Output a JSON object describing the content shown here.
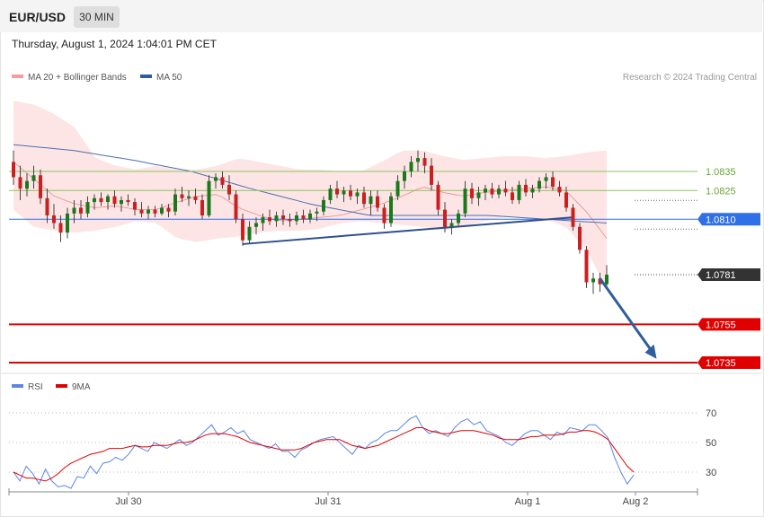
{
  "header": {
    "symbol": "EUR/USD",
    "timeframe": "30 MIN"
  },
  "datetime": "Thursday, August 1, 2024 1:04:01 PM CET",
  "credit": "Research © 2024 Trading Central",
  "colors": {
    "bollinger": "#f99b9b",
    "ma50": "#2f5d9e",
    "rsi": "#5b86e5",
    "ma9": "#e00000",
    "support": "#e00000",
    "pivot": "#2f6fe8",
    "resistance": "#8fc25e",
    "current": "#333333"
  },
  "price_legend": [
    {
      "label": "MA 20 + Bollinger Bands",
      "color": "#f99b9b"
    },
    {
      "label": "MA 50",
      "color": "#2f5d9e"
    }
  ],
  "rsi_legend": [
    {
      "label": "RSI",
      "color": "#5b86e5"
    },
    {
      "label": "9MA",
      "color": "#e00000"
    }
  ],
  "chart_data": [
    {
      "type": "candlestick",
      "x_ticks": [
        "Jul 30",
        "Jul 31",
        "Aug 1",
        "Aug 2"
      ],
      "ylim": [
        1.0728,
        1.0885
      ],
      "levels": [
        {
          "value": 1.0835,
          "label": "1.0835",
          "kind": "resistance",
          "color": "#8fc25e"
        },
        {
          "value": 1.0825,
          "label": "1.0825",
          "kind": "resistance",
          "color": "#8fc25e"
        },
        {
          "value": 1.081,
          "label": "1.0810",
          "kind": "pivot",
          "color": "#2f6fe8"
        },
        {
          "value": 1.0781,
          "label": "1.0781",
          "kind": "current",
          "color": "#333333"
        },
        {
          "value": 1.0755,
          "label": "1.0755",
          "kind": "support",
          "color": "#e00000"
        },
        {
          "value": 1.0735,
          "label": "1.0735",
          "kind": "support",
          "color": "#e00000"
        }
      ],
      "trendline": {
        "from": {
          "bar": 34,
          "price": 1.0797
        },
        "to": {
          "bar": 83,
          "price": 1.0811
        }
      },
      "forecast_arrow": {
        "from": {
          "bar": 87,
          "price": 1.0779
        },
        "to": {
          "bar": 95,
          "price": 1.0737
        }
      },
      "ohlc": [
        [
          1.084,
          1.0846,
          1.0828,
          1.0832
        ],
        [
          1.0832,
          1.0838,
          1.082,
          1.0826
        ],
        [
          1.0826,
          1.0834,
          1.0822,
          1.083
        ],
        [
          1.083,
          1.0838,
          1.0826,
          1.0833
        ],
        [
          1.0833,
          1.0836,
          1.0818,
          1.0821
        ],
        [
          1.0821,
          1.0826,
          1.0808,
          1.0812
        ],
        [
          1.0812,
          1.0818,
          1.0805,
          1.0808
        ],
        [
          1.0808,
          1.0812,
          1.0798,
          1.0803
        ],
        [
          1.0803,
          1.0816,
          1.08,
          1.0813
        ],
        [
          1.0813,
          1.082,
          1.0808,
          1.0816
        ],
        [
          1.0816,
          1.082,
          1.081,
          1.0813
        ],
        [
          1.0813,
          1.0822,
          1.0811,
          1.0819
        ],
        [
          1.0819,
          1.0823,
          1.0815,
          1.0821
        ],
        [
          1.0821,
          1.0824,
          1.0817,
          1.0819
        ],
        [
          1.0819,
          1.0823,
          1.0815,
          1.0822
        ],
        [
          1.0822,
          1.0825,
          1.0816,
          1.0818
        ],
        [
          1.0818,
          1.0822,
          1.0814,
          1.082
        ],
        [
          1.082,
          1.0823,
          1.0817,
          1.0819
        ],
        [
          1.0819,
          1.0821,
          1.0812,
          1.0815
        ],
        [
          1.0815,
          1.0819,
          1.0811,
          1.0813
        ],
        [
          1.0813,
          1.0817,
          1.081,
          1.0815
        ],
        [
          1.0815,
          1.0817,
          1.0811,
          1.0813
        ],
        [
          1.0813,
          1.0818,
          1.0812,
          1.0816
        ],
        [
          1.0816,
          1.0818,
          1.0811,
          1.0814
        ],
        [
          1.0814,
          1.0826,
          1.0812,
          1.0823
        ],
        [
          1.0823,
          1.0827,
          1.0819,
          1.0821
        ],
        [
          1.0821,
          1.0825,
          1.0817,
          1.0822
        ],
        [
          1.0822,
          1.0826,
          1.0818,
          1.082
        ],
        [
          1.082,
          1.0823,
          1.081,
          1.0812
        ],
        [
          1.0812,
          1.0833,
          1.0811,
          1.083
        ],
        [
          1.083,
          1.0834,
          1.0826,
          1.0832
        ],
        [
          1.0832,
          1.0835,
          1.0826,
          1.0828
        ],
        [
          1.0828,
          1.0833,
          1.082,
          1.0823
        ],
        [
          1.0823,
          1.0825,
          1.0808,
          1.081
        ],
        [
          1.081,
          1.0813,
          1.0796,
          1.0799
        ],
        [
          1.0799,
          1.0809,
          1.0797,
          1.0806
        ],
        [
          1.0806,
          1.0811,
          1.0802,
          1.0808
        ],
        [
          1.0808,
          1.0813,
          1.0804,
          1.0811
        ],
        [
          1.0811,
          1.0815,
          1.0807,
          1.0809
        ],
        [
          1.0809,
          1.0814,
          1.0806,
          1.0812
        ],
        [
          1.0812,
          1.0815,
          1.0807,
          1.081
        ],
        [
          1.081,
          1.0813,
          1.0806,
          1.0809
        ],
        [
          1.0809,
          1.0814,
          1.0807,
          1.0812
        ],
        [
          1.0812,
          1.0815,
          1.0808,
          1.081
        ],
        [
          1.081,
          1.0815,
          1.0808,
          1.0813
        ],
        [
          1.0813,
          1.0816,
          1.0809,
          1.0814
        ],
        [
          1.0814,
          1.0822,
          1.0812,
          1.082
        ],
        [
          1.082,
          1.0828,
          1.0818,
          1.0826
        ],
        [
          1.0826,
          1.083,
          1.0821,
          1.0823
        ],
        [
          1.0823,
          1.0827,
          1.0819,
          1.0825
        ],
        [
          1.0825,
          1.0828,
          1.082,
          1.0822
        ],
        [
          1.0822,
          1.0826,
          1.0818,
          1.0824
        ],
        [
          1.0824,
          1.0827,
          1.0816,
          1.0818
        ],
        [
          1.0818,
          1.0825,
          1.0812,
          1.0822
        ],
        [
          1.0822,
          1.0825,
          1.0814,
          1.0816
        ],
        [
          1.0816,
          1.0818,
          1.0805,
          1.0808
        ],
        [
          1.0808,
          1.0824,
          1.0806,
          1.0822
        ],
        [
          1.0822,
          1.0833,
          1.082,
          1.083
        ],
        [
          1.083,
          1.0838,
          1.0826,
          1.0835
        ],
        [
          1.0835,
          1.0843,
          1.0832,
          1.084
        ],
        [
          1.084,
          1.0846,
          1.0835,
          1.0842
        ],
        [
          1.0842,
          1.0845,
          1.0834,
          1.0838
        ],
        [
          1.0838,
          1.0842,
          1.0825,
          1.0828
        ],
        [
          1.0828,
          1.083,
          1.0812,
          1.0815
        ],
        [
          1.0815,
          1.0819,
          1.0803,
          1.0806
        ],
        [
          1.0806,
          1.081,
          1.0802,
          1.0808
        ],
        [
          1.0808,
          1.0815,
          1.0806,
          1.0813
        ],
        [
          1.0813,
          1.083,
          1.0811,
          1.0826
        ],
        [
          1.0826,
          1.0829,
          1.0818,
          1.0821
        ],
        [
          1.0821,
          1.0827,
          1.0817,
          1.0824
        ],
        [
          1.0824,
          1.0828,
          1.082,
          1.0826
        ],
        [
          1.0826,
          1.0829,
          1.0821,
          1.0823
        ],
        [
          1.0823,
          1.0828,
          1.0821,
          1.0826
        ],
        [
          1.0826,
          1.083,
          1.0822,
          1.0824
        ],
        [
          1.0824,
          1.0827,
          1.0818,
          1.082
        ],
        [
          1.082,
          1.083,
          1.0818,
          1.0828
        ],
        [
          1.0828,
          1.0831,
          1.0822,
          1.0824
        ],
        [
          1.0824,
          1.0828,
          1.0821,
          1.0826
        ],
        [
          1.0826,
          1.0832,
          1.0824,
          1.083
        ],
        [
          1.083,
          1.0834,
          1.0826,
          1.0832
        ],
        [
          1.0832,
          1.0835,
          1.0825,
          1.0827
        ],
        [
          1.0827,
          1.083,
          1.0822,
          1.0824
        ],
        [
          1.0824,
          1.0827,
          1.0814,
          1.0816
        ],
        [
          1.0816,
          1.0818,
          1.0804,
          1.0806
        ],
        [
          1.0806,
          1.0808,
          1.0792,
          1.0794
        ],
        [
          1.0794,
          1.0796,
          1.0774,
          1.0777
        ],
        [
          1.0777,
          1.0782,
          1.0771,
          1.0779
        ],
        [
          1.0779,
          1.0782,
          1.0772,
          1.0776
        ],
        [
          1.0776,
          1.0786,
          1.0774,
          1.0781
        ]
      ],
      "ma50": [
        1.0849,
        1.0846,
        1.0841,
        1.0835,
        1.0826,
        1.0818,
        1.0812,
        1.0812,
        1.0812,
        1.081,
        1.0808
      ],
      "ma20": [
        1.084,
        1.0831,
        1.0822,
        1.0818,
        1.0816,
        1.0817,
        1.0815,
        1.0815,
        1.0819,
        1.0822,
        1.0823,
        1.0816,
        1.0812,
        1.0809,
        1.081,
        1.0811,
        1.0812,
        1.0815,
        1.0818,
        1.0822,
        1.0827,
        1.0824,
        1.0822,
        1.0824,
        1.0825,
        1.0826,
        1.0827,
        1.0825,
        1.0814,
        1.08
      ],
      "bb_upper": [
        1.0872,
        1.087,
        1.0865,
        1.0858,
        1.0842,
        1.0838,
        1.0836,
        1.0838,
        1.0836,
        1.0836,
        1.0838,
        1.0842,
        1.084,
        1.0838,
        1.0836,
        1.0836,
        1.0835,
        1.0835,
        1.084,
        1.0846,
        1.0846,
        1.0843,
        1.0841,
        1.0842,
        1.0843,
        1.0843,
        1.0842,
        1.0843,
        1.0845,
        1.0846
      ],
      "bb_lower": [
        1.0815,
        1.0806,
        1.0804,
        1.0803,
        1.0804,
        1.0806,
        1.0809,
        1.0808,
        1.08,
        1.0798,
        1.08,
        1.0801,
        1.0803,
        1.0804,
        1.0804,
        1.0805,
        1.0808,
        1.0809,
        1.0808,
        1.0807,
        1.0806,
        1.0804,
        1.0806,
        1.0809,
        1.0811,
        1.0811,
        1.081,
        1.0806,
        1.0794,
        1.0774
      ]
    },
    {
      "type": "line",
      "name": "RSI",
      "ylim": [
        20,
        80
      ],
      "y_ticks": [
        "70",
        "50",
        "30"
      ],
      "y_tick_values": [
        70,
        50,
        30
      ],
      "rsi": [
        30,
        24,
        34,
        29,
        22,
        32,
        24,
        20,
        21,
        19,
        27,
        26,
        34,
        29,
        36,
        37,
        40,
        38,
        42,
        48,
        46,
        44,
        50,
        48,
        46,
        49,
        52,
        48,
        50,
        54,
        58,
        62,
        55,
        57,
        60,
        56,
        58,
        52,
        50,
        48,
        46,
        49,
        44,
        44,
        40,
        45,
        47,
        50,
        52,
        53,
        54,
        50,
        46,
        42,
        48,
        46,
        50,
        52,
        56,
        58,
        58,
        62,
        66,
        68,
        60,
        56,
        58,
        56,
        54,
        60,
        64,
        66,
        62,
        64,
        58,
        56,
        54,
        50,
        48,
        52,
        56,
        58,
        58,
        55,
        52,
        57,
        55,
        60,
        59,
        58,
        62,
        62,
        58,
        53,
        40,
        30,
        22,
        28
      ],
      "ma9": [
        30,
        28,
        26,
        26,
        25,
        24,
        26,
        29,
        33,
        36,
        38,
        40,
        42,
        43,
        44,
        46,
        46,
        46,
        47,
        48,
        47,
        47,
        48,
        48,
        48,
        49,
        50,
        50,
        51,
        53,
        55,
        56,
        56,
        56,
        55,
        54,
        52,
        50,
        49,
        48,
        47,
        46,
        45,
        45,
        45,
        46,
        48,
        50,
        51,
        52,
        52,
        52,
        50,
        48,
        47,
        46,
        47,
        48,
        50,
        52,
        54,
        56,
        58,
        60,
        60,
        58,
        57,
        56,
        56,
        57,
        58,
        58,
        58,
        57,
        56,
        55,
        53,
        52,
        52,
        52,
        53,
        54,
        54,
        55,
        55,
        55,
        56,
        57,
        57,
        58,
        58,
        57,
        55,
        52,
        46,
        40,
        34,
        30
      ]
    }
  ]
}
